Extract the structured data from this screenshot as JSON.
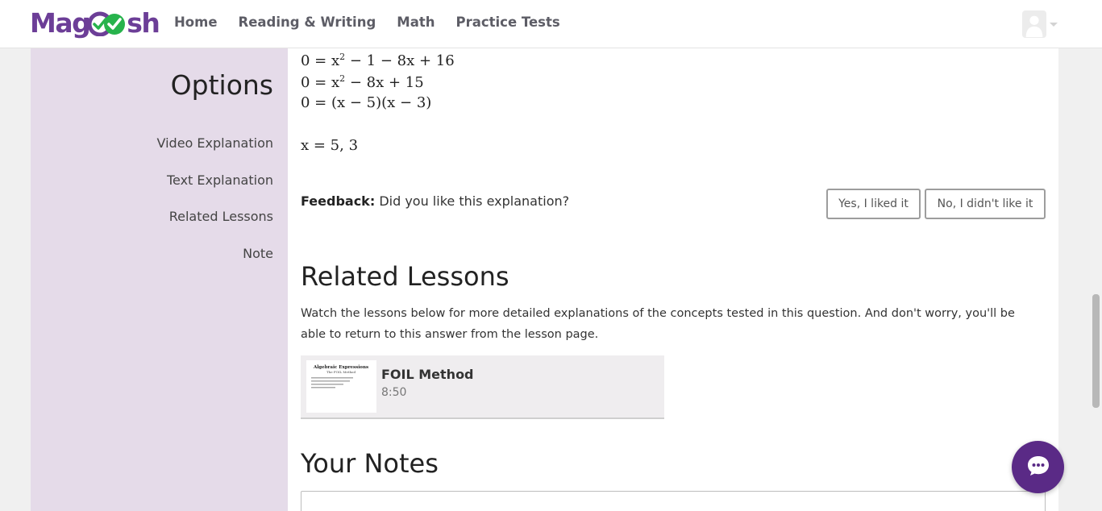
{
  "header": {
    "logo_text_left": "Mag",
    "logo_text_right": "sh",
    "nav": [
      {
        "label": "Home"
      },
      {
        "label": "Reading & Writing"
      },
      {
        "label": "Math"
      },
      {
        "label": "Practice Tests"
      }
    ],
    "account_icon": "user-avatar-icon"
  },
  "sidebar": {
    "title": "Options",
    "items": [
      {
        "label": "Video Explanation"
      },
      {
        "label": "Text Explanation"
      },
      {
        "label": "Related Lessons"
      },
      {
        "label": "Note"
      }
    ]
  },
  "explanation": {
    "steps": [
      {
        "lhs": "0 = x",
        "exp": "2",
        "rhs": " − 1 − 8x + 16"
      },
      {
        "lhs": "0 = x",
        "exp": "2",
        "rhs": " − 8x + 15"
      },
      {
        "lhs": "0 = (x − 5)(x − 3)",
        "exp": "",
        "rhs": ""
      }
    ],
    "answer": "x = 5, 3"
  },
  "feedback": {
    "label": "Feedback:",
    "question": "Did you like this explanation?",
    "yes_label": "Yes, I liked it",
    "no_label": "No, I didn't like it"
  },
  "related": {
    "heading": "Related Lessons",
    "description": "Watch the lessons below for more detailed explanations of the concepts tested in this question. And don't worry, you'll be able to return to this answer from the lesson page.",
    "lessons": [
      {
        "title": "FOIL Method",
        "duration": "8:50",
        "thumb_title": "Algebraic Expressions",
        "thumb_subtitle": "The FOIL Method"
      }
    ]
  },
  "notes": {
    "heading": "Your Notes"
  },
  "chat": {
    "icon": "chat-bubble-icon"
  },
  "colors": {
    "brand_purple": "#6c3e97",
    "brand_green": "#27b34c",
    "sidebar_bg": "#e5dbe9",
    "chat_bg": "#5a2a86"
  }
}
